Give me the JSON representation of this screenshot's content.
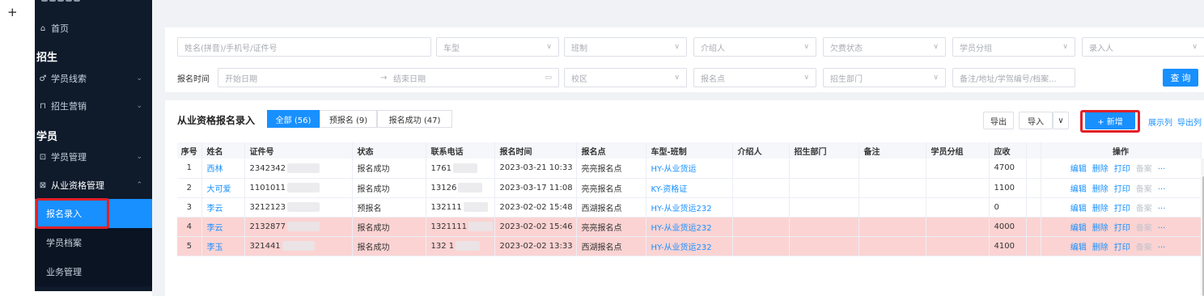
{
  "plus_symbol": "+",
  "sidebar": {
    "home": "首页",
    "group_enroll": "招生",
    "leads": "学员线索",
    "marketing": "招生营销",
    "group_student": "学员",
    "student_mgmt": "学员管理",
    "qual_mgmt": "从业资格管理",
    "sub_enroll": "报名录入",
    "sub_archive": "学员档案",
    "sub_business": "业务管理"
  },
  "filters": {
    "name_placeholder": "姓名(拼音)/手机号/证件号",
    "car_type": "车型",
    "class_system": "班制",
    "referrer": "介绍人",
    "arrears": "欠费状态",
    "student_group": "学员分组",
    "entered_by": "录入人",
    "date_label": "报名时间",
    "start_date": "开始日期",
    "range_sep": "→",
    "end_date": "结束日期",
    "campus": "校区",
    "enroll_point": "报名点",
    "dept": "招生部门",
    "remark": "备注/地址/学驾编号/档案...",
    "query_btn": "查 询"
  },
  "panel": {
    "title": "从业资格报名录入",
    "tab_all": "全部 (56)",
    "tab_pre": "预报名 (9)",
    "tab_success": "报名成功 (47)",
    "export": "导出",
    "import": "导入",
    "add": "+ 新增",
    "show_cols": "展示列",
    "export_cols": "导出列"
  },
  "table": {
    "headers": [
      "序号",
      "姓名",
      "证件号",
      "状态",
      "联系电话",
      "报名时间",
      "报名点",
      "车型-班制",
      "介绍人",
      "招生部门",
      "备注",
      "学员分组",
      "应收",
      "",
      "操作"
    ],
    "rows": [
      {
        "no": "1",
        "name": "西林",
        "id": "2342342",
        "status": "报名成功",
        "phone": "1761",
        "time": "2023-03-21 10:33",
        "point": "亮亮报名点",
        "car": "HY-从业货运",
        "fee": "4700"
      },
      {
        "no": "2",
        "name": "大可爱",
        "id": "1101011",
        "status": "报名成功",
        "phone": "13126",
        "time": "2023-03-17 11:08",
        "point": "亮亮报名点",
        "car": "KY-资格证",
        "fee": "1100"
      },
      {
        "no": "3",
        "name": "李云",
        "id": "3212123",
        "status": "预报名",
        "phone": "132111",
        "time": "2023-02-02 15:48",
        "point": "西湖报名点",
        "car": "HY-从业货运232",
        "fee": "0"
      },
      {
        "no": "4",
        "name": "李云",
        "id": "2132877",
        "status": "报名成功",
        "phone": "1321111",
        "time": "2023-02-02 15:46",
        "point": "亮亮报名点",
        "car": "HY-从业货运232",
        "fee": "4000"
      },
      {
        "no": "5",
        "name": "李玉",
        "id": "321441",
        "status": "报名成功",
        "phone": "132 1",
        "time": "2023-02-02 13:33",
        "point": "西湖报名点",
        "car": "HY-从业货运232",
        "fee": "4100"
      }
    ],
    "ops": {
      "edit": "编辑",
      "delete": "删除",
      "print": "打印",
      "archive": "备案",
      "more": "···"
    }
  }
}
